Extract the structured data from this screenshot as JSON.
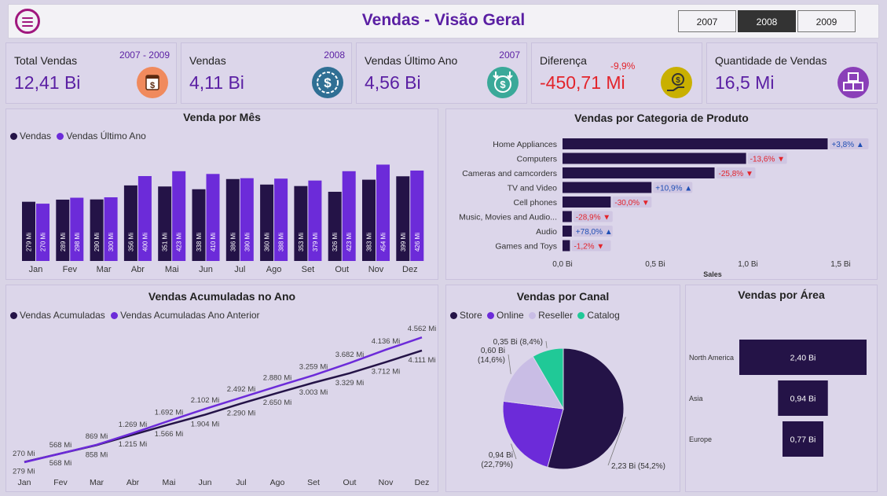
{
  "header": {
    "title": "Vendas - Visão Geral",
    "years": [
      "2007",
      "2008",
      "2009"
    ],
    "selected_year": "2008"
  },
  "colors": {
    "dark": "#241347",
    "purple": "#6c2bd9",
    "light": "#c9bde5",
    "teal": "#20c997",
    "negative": "#e3242b",
    "positive": "#1f4fb5",
    "accent": "#5a1fa3"
  },
  "kpis": [
    {
      "label": "Total Vendas",
      "sub": "2007 - 2009",
      "value": "12,41 Bi",
      "icon": "calendar-money-icon"
    },
    {
      "label": "Vendas",
      "sub": "2008",
      "value": "4,11 Bi",
      "icon": "dollar-coin-icon"
    },
    {
      "label": "Vendas Último Ano",
      "sub": "2007",
      "value": "4,56 Bi",
      "icon": "money-down-icon"
    },
    {
      "label": "Diferença",
      "sub": "-9,9%",
      "value": "-450,71 Mi",
      "icon": "hand-money-icon"
    },
    {
      "label": "Quantidade de Vendas",
      "sub": "",
      "value": "16,5 Mi",
      "icon": "boxes-icon"
    }
  ],
  "monthly": {
    "title": "Venda por Mês",
    "legend": [
      "Vendas",
      "Vendas Último Ano"
    ]
  },
  "category": {
    "title": "Vendas por Categoria de Produto",
    "xlabel": "Sales",
    "ticks": [
      "0,0 Bi",
      "0,5 Bi",
      "1,0 Bi",
      "1,5 Bi"
    ]
  },
  "cumulative": {
    "title": "Vendas Acumuladas no Ano",
    "legend": [
      "Vendas Acumuladas",
      "Vendas Acumuladas Ano Anterior"
    ]
  },
  "channel": {
    "title": "Vendas por Canal",
    "legend": [
      "Store",
      "Online",
      "Reseller",
      "Catalog"
    ]
  },
  "area": {
    "title": "Vendas por Área"
  },
  "chart_data": [
    {
      "type": "bar",
      "title": "Venda por Mês",
      "categories": [
        "Jan",
        "Fev",
        "Mar",
        "Abr",
        "Mai",
        "Jun",
        "Jul",
        "Ago",
        "Set",
        "Out",
        "Nov",
        "Dez"
      ],
      "series": [
        {
          "name": "Vendas",
          "values": [
            279,
            289,
            290,
            356,
            351,
            338,
            386,
            360,
            353,
            326,
            383,
            399
          ],
          "labels": [
            "279 Mi",
            "289 Mi",
            "290 Mi",
            "356 Mi",
            "351 Mi",
            "338 Mi",
            "386 Mi",
            "360 Mi",
            "353 Mi",
            "326 Mi",
            "383 Mi",
            "399 Mi"
          ]
        },
        {
          "name": "Vendas Último Ano",
          "values": [
            270,
            298,
            300,
            400,
            423,
            410,
            390,
            388,
            379,
            423,
            454,
            426
          ],
          "labels": [
            "270 Mi",
            "298 Mi",
            "300 Mi",
            "400 Mi",
            "423 Mi",
            "410 Mi",
            "390 Mi",
            "388 Mi",
            "379 Mi",
            "423 Mi",
            "454 Mi",
            "426 Mi"
          ]
        }
      ]
    },
    {
      "type": "bar",
      "title": "Vendas por Categoria de Produto",
      "categories": [
        "Home Appliances",
        "Computers",
        "Cameras and camcorders",
        "TV and Video",
        "Cell phones",
        "Music, Movies and Audio...",
        "Audio",
        "Games and Toys"
      ],
      "values": [
        1.43,
        0.99,
        0.82,
        0.48,
        0.26,
        0.05,
        0.05,
        0.04
      ],
      "deltas": [
        "+3,8%",
        "-13,6%",
        "-25,8%",
        "+10,9%",
        "-30,0%",
        "-28,9%",
        "+78,0%",
        "-1,2%"
      ],
      "xlabel": "Sales",
      "xlim": [
        0,
        1.6
      ]
    },
    {
      "type": "line",
      "title": "Vendas Acumuladas no Ano",
      "categories": [
        "Jan",
        "Fev",
        "Mar",
        "Abr",
        "Mai",
        "Jun",
        "Jul",
        "Ago",
        "Set",
        "Out",
        "Nov",
        "Dez"
      ],
      "series": [
        {
          "name": "Vendas Acumuladas",
          "values": [
            279,
            568,
            858,
            1215,
            1566,
            1904,
            2290,
            2650,
            3003,
            3329,
            3712,
            4111
          ],
          "labels": [
            "279 Mi",
            "568 Mi",
            "858 Mi",
            "1.215 Mi",
            "1.566 Mi",
            "1.904 Mi",
            "2.290 Mi",
            "2.650 Mi",
            "3.003 Mi",
            "3.329 Mi",
            "3.712 Mi",
            "4.111 Mi"
          ]
        },
        {
          "name": "Vendas Acumuladas Ano Anterior",
          "values": [
            270,
            568,
            869,
            1269,
            1692,
            2102,
            2492,
            2880,
            3259,
            3682,
            4136,
            4562
          ],
          "labels": [
            "270 Mi",
            "568 Mi",
            "869 Mi",
            "1.269 Mi",
            "1.692 Mi",
            "2.102 Mi",
            "2.492 Mi",
            "2.880 Mi",
            "3.259 Mi",
            "3.682 Mi",
            "4.136 Mi",
            "4.562 Mi"
          ]
        }
      ],
      "ylim": [
        0,
        4800
      ]
    },
    {
      "type": "pie",
      "title": "Vendas por Canal",
      "labels": [
        "Store",
        "Online",
        "Reseller",
        "Catalog"
      ],
      "values": [
        54.2,
        22.79,
        14.6,
        8.4
      ],
      "value_labels": [
        "2,23 Bi (54,2%)",
        "0,94 Bi (22,79%)",
        "0,60 Bi (14,6%)",
        "0,35 Bi (8,4%)"
      ]
    },
    {
      "type": "bar",
      "title": "Vendas por Área",
      "categories": [
        "North America",
        "Asia",
        "Europe"
      ],
      "values": [
        2.4,
        0.94,
        0.77
      ],
      "value_labels": [
        "2,40 Bi",
        "0,94 Bi",
        "0,77 Bi"
      ]
    }
  ]
}
